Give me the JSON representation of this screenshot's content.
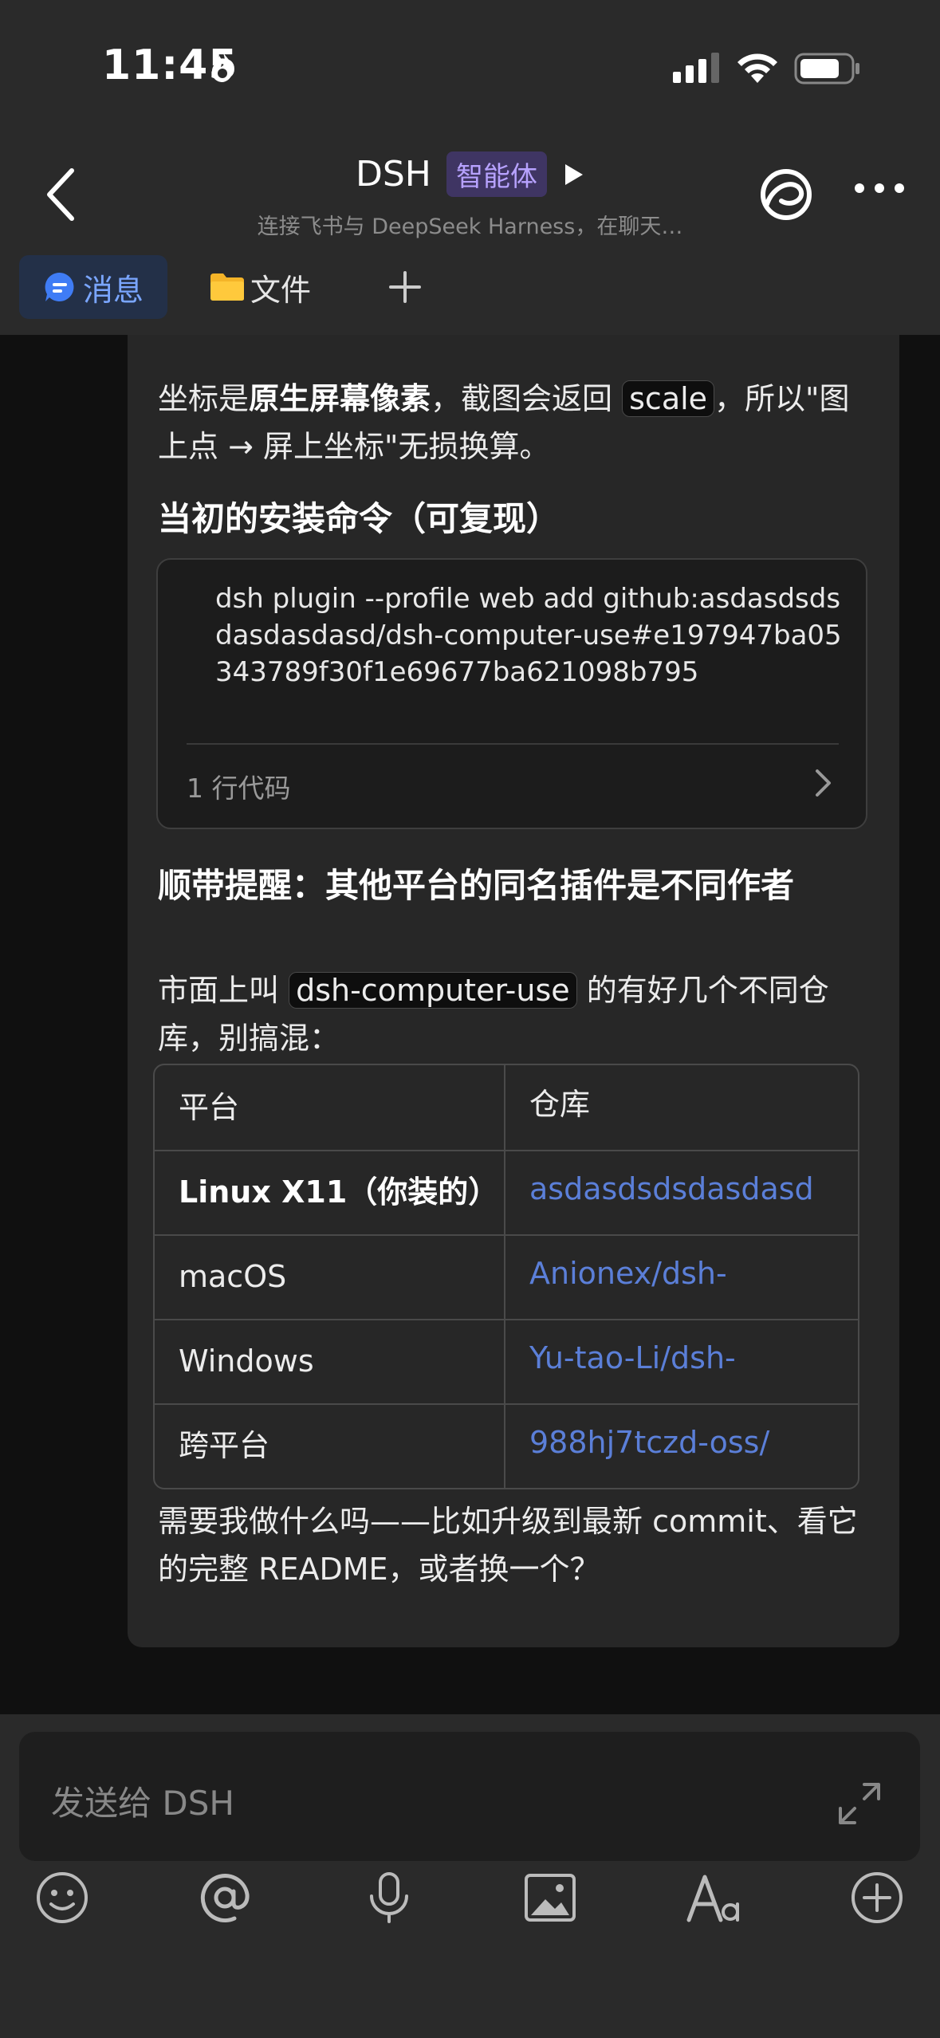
{
  "status": {
    "time": "11:45"
  },
  "header": {
    "title": "DSH",
    "badge": "智能体",
    "subtitle": "连接飞书与 DeepSeek Harness，在聊天…"
  },
  "tabs": [
    {
      "label": "消息",
      "active": true
    },
    {
      "label": "文件"
    }
  ],
  "message": {
    "p1_a": "坐标是",
    "p1_bold": "原生屏幕像素",
    "p1_b": "，截图会返回 ",
    "p1_code": "scale",
    "p1_c": "，所以\"图上点 → 屏上坐标\"无损换算。",
    "h_install": "当初的安装命令（可复现）",
    "code": "dsh plugin --profile web add github:asdasdsdsdasdasdasd/dsh-computer-use#e197947ba05343789f30f1e69677ba621098b795",
    "code_footer": "1 行代码",
    "h_reminder": "顺带提醒：其他平台的同名插件是不同作者",
    "p2_a": "市面上叫 ",
    "p2_code": "dsh-computer-use",
    "p2_b": " 的有好几个不同仓库，别搞混：",
    "table": {
      "headers": [
        "平台",
        "仓库"
      ],
      "rows": [
        [
          "Linux X11（你装的）",
          "asdasdsdsdasdasd"
        ],
        [
          "macOS",
          "Anionex/dsh-"
        ],
        [
          "Windows",
          "Yu-tao-Li/dsh-"
        ],
        [
          "跨平台",
          "988hj7tczd-oss/"
        ]
      ]
    },
    "p3": "需要我做什么吗——比如升级到最新 commit、看它的完整 README，或者换一个？"
  },
  "composer": {
    "placeholder": "发送给 DSH"
  },
  "colors": {
    "accent": "#5b7fd8",
    "badge": "#b7a2ff",
    "background": "#000000"
  }
}
